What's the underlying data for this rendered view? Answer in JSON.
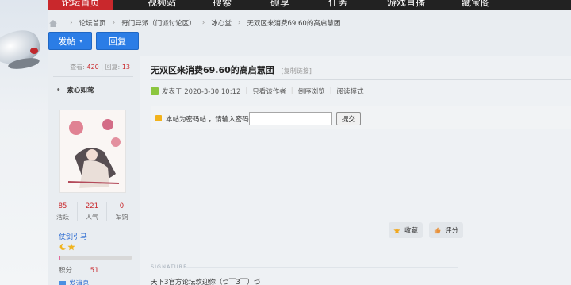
{
  "nav": {
    "items": [
      {
        "label": "论坛首页",
        "active": true
      },
      {
        "label": "视频站"
      },
      {
        "label": "搜索"
      },
      {
        "label": "硕享"
      },
      {
        "label": "任务"
      },
      {
        "label": "游戏直播"
      },
      {
        "label": "藏宝阁"
      }
    ]
  },
  "breadcrumb": [
    "论坛首页",
    "奇门异派（门派讨论区）",
    "冰心堂",
    "无双区来消费69.60的高启慧团"
  ],
  "buttons": {
    "post": "发帖",
    "reply": "回复"
  },
  "sidebar": {
    "views_label": "查看:",
    "views": "420",
    "replies_label": "回复:",
    "replies": "13",
    "author": "素心如莺",
    "metrics": [
      {
        "value": "85",
        "label": "活跃"
      },
      {
        "value": "221",
        "label": "人气"
      },
      {
        "value": "0",
        "label": "军饷"
      }
    ],
    "rank": "仗剑引马",
    "points_label": "积分",
    "points": "51",
    "message": "发消息"
  },
  "post": {
    "title": "无双区来消费69.60的高启慧团",
    "copy_link": "[复制链接]",
    "posted": "发表于 2020-3-30 10:12",
    "only_author": "只看该作者",
    "reverse": "倒序浏览",
    "read_mode": "阅读模式",
    "locked_text": "本帖为密码帖 ，请输入密码",
    "submit": "提交",
    "favorite": "收藏",
    "rate": "评分",
    "signature_label": "SIGNATURE",
    "signature": "天下3官方论坛欢迎你（づ￣3￣）づ"
  },
  "colors": {
    "accent": "#2b7de6",
    "brand_red": "#c9282c"
  }
}
